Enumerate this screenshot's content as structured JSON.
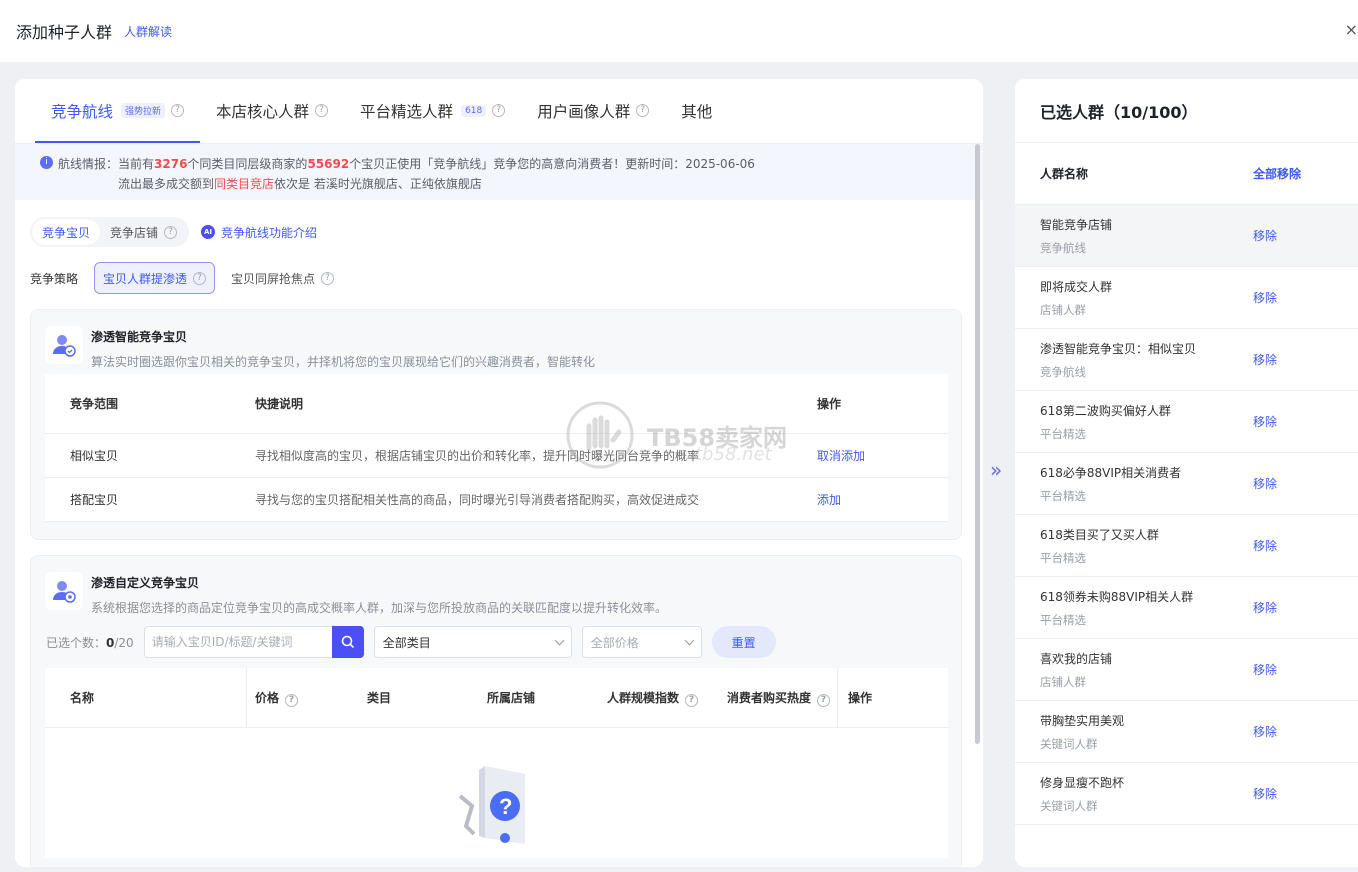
{
  "header": {
    "title": "添加种子人群",
    "link": "人群解读",
    "close": "×"
  },
  "tabs": [
    {
      "label": "竞争航线",
      "badge": "强势拉新",
      "active": true
    },
    {
      "label": "本店核心人群",
      "badge": ""
    },
    {
      "label": "平台精选人群",
      "badge": "618"
    },
    {
      "label": "用户画像人群",
      "badge": ""
    },
    {
      "label": "其他",
      "badge": ""
    }
  ],
  "notice": {
    "prefix": "航线情报：当前有",
    "count1": "3276",
    "mid1": "个同类目同层级商家的",
    "count2": "55692",
    "mid2": "个宝贝正使用「竞争航线」竞争您的高意向消费者！更新时间：2025-06-06",
    "line2_prefix": "流出最多成交额到",
    "line2_red": "同类目竞店",
    "line2_suffix": "依次是 若溪时光旗舰店、正纯依旗舰店"
  },
  "subtabs": {
    "items": [
      "竞争宝贝",
      "竞争店铺"
    ],
    "active": 0,
    "ai_label": "竞争航线功能介绍"
  },
  "strategy": {
    "label": "竞争策略",
    "options": [
      "宝贝人群提渗透",
      "宝贝同屏抢焦点"
    ],
    "active": 0
  },
  "card1": {
    "title": "渗透智能竞争宝贝",
    "desc": "算法实时圈选跟你宝贝相关的竞争宝贝，并择机将您的宝贝展现给它们的兴趣消费者，智能转化",
    "columns": [
      "竞争范围",
      "快捷说明",
      "操作"
    ],
    "rows": [
      {
        "scope": "相似宝贝",
        "desc": "寻找相似度高的宝贝，根据店铺宝贝的出价和转化率，提升同时曝光同台竞争的概率",
        "action": "取消添加"
      },
      {
        "scope": "搭配宝贝",
        "desc": "寻找与您的宝贝搭配相关性高的商品，同时曝光引导消费者搭配购买，高效促进成交",
        "action": "添加"
      }
    ]
  },
  "card2": {
    "title": "渗透自定义竞争宝贝",
    "desc": "系统根据您选择的商品定位竞争宝贝的高成交概率人群，加深与您所投放商品的关联匹配度以提升转化效率。",
    "selected_label": "已选个数：",
    "selected_count": "0",
    "selected_total": "/20",
    "search_placeholder": "请输入宝贝ID/标题/关键词",
    "category_select": "全部类目",
    "price_select": "全部价格",
    "reset": "重置",
    "columns": [
      "名称",
      "价格",
      "类目",
      "所属店铺",
      "人群规模指数",
      "消费者购买热度",
      "操作"
    ]
  },
  "watermark": {
    "brand": "TB58卖家网",
    "url": "tb58.net"
  },
  "right": {
    "title": "已选人群（10/100）",
    "col_name": "人群名称",
    "remove_all": "全部移除",
    "remove_label": "移除",
    "items": [
      {
        "name": "智能竞争店铺",
        "type": "竞争航线"
      },
      {
        "name": "即将成交人群",
        "type": "店铺人群"
      },
      {
        "name": "渗透智能竞争宝贝：相似宝贝",
        "type": "竞争航线"
      },
      {
        "name": "618第二波购买偏好人群",
        "type": "平台精选"
      },
      {
        "name": "618必争88VIP相关消费者",
        "type": "平台精选"
      },
      {
        "name": "618类目买了又买人群",
        "type": "平台精选"
      },
      {
        "name": "618领券未购88VIP相关人群",
        "type": "平台精选"
      },
      {
        "name": "喜欢我的店铺",
        "type": "店铺人群"
      },
      {
        "name": "带胸垫实用美观",
        "type": "关键词人群"
      },
      {
        "name": "修身显瘦不跑杯",
        "type": "关键词人群"
      }
    ]
  },
  "colors": {
    "accent": "#3d5afe",
    "highlight": "#f54b4b"
  }
}
